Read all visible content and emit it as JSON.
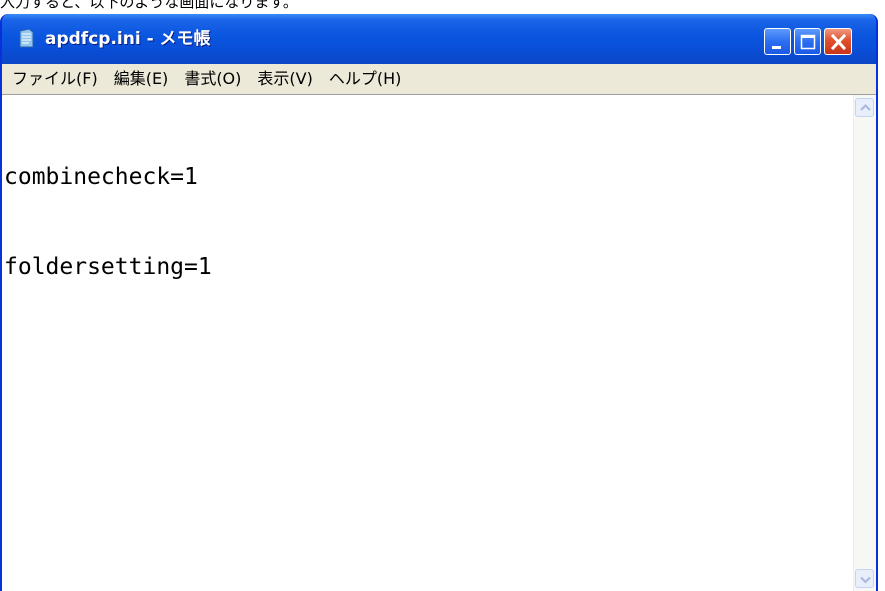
{
  "caption": "入力すると、以下のような画面になります。",
  "window": {
    "title": "apdfcp.ini - メモ帳",
    "icon": "notepad-icon",
    "controls": {
      "minimize_icon": "minimize-icon",
      "maximize_icon": "maximize-icon",
      "close_icon": "close-icon"
    }
  },
  "menu": {
    "file": "ファイル(F)",
    "edit": "編集(E)",
    "format": "書式(O)",
    "view": "表示(V)",
    "help": "ヘルプ(H)"
  },
  "editor": {
    "line1": "combinecheck=1",
    "line2": "foldersetting=1"
  },
  "colors": {
    "titlebar": "#0a55df",
    "close_button": "#e0502c",
    "menubar": "#ece9d8"
  }
}
